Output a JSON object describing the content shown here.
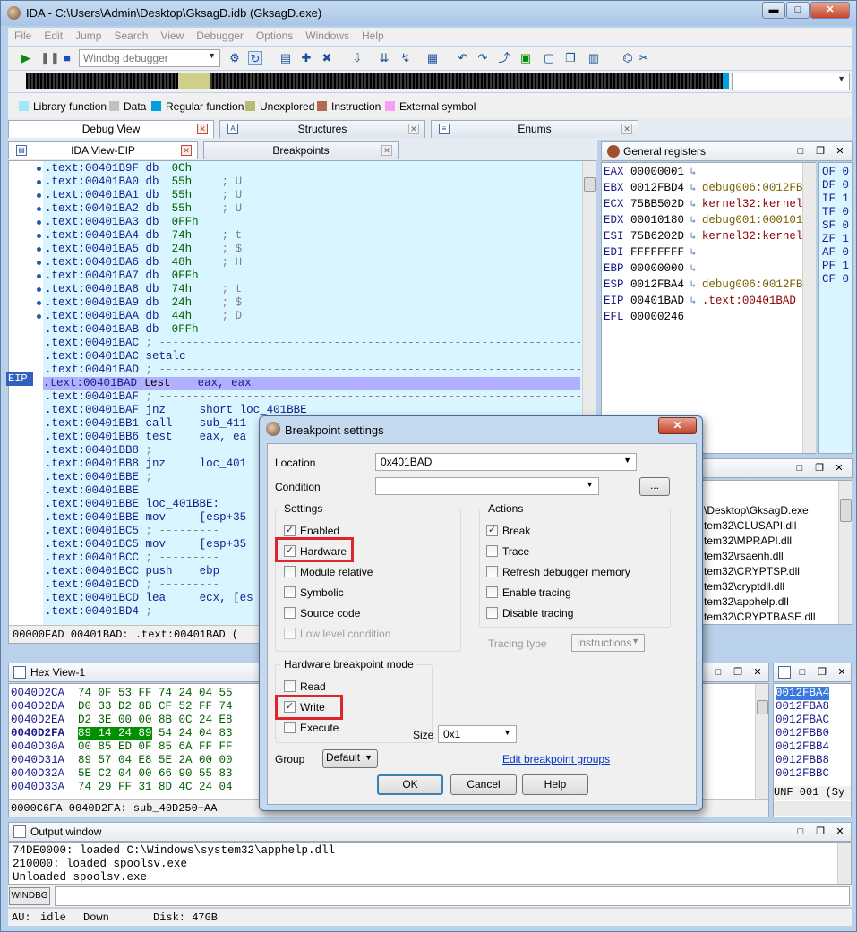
{
  "window": {
    "title": "IDA - C:\\Users\\Admin\\Desktop\\GksagD.idb (GksagD.exe)",
    "minimize": "▬",
    "maximize": "□",
    "close": "✕"
  },
  "menu": [
    "File",
    "Edit",
    "Jump",
    "Search",
    "View",
    "Debugger",
    "Options",
    "Windows",
    "Help"
  ],
  "toolbar": {
    "debugger_select": "Windbg debugger",
    "icons": [
      "play-icon",
      "pause-icon",
      "stop-icon"
    ]
  },
  "legend": [
    {
      "label": "Library function",
      "color": "#9fe8f5"
    },
    {
      "label": "Data",
      "color": "#c0c0c0"
    },
    {
      "label": "Regular function",
      "color": "#00a0e0"
    },
    {
      "label": "Unexplored",
      "color": "#b8b878"
    },
    {
      "label": "Instruction",
      "color": "#b06a50"
    },
    {
      "label": "External symbol",
      "color": "#f5a0f5"
    }
  ],
  "top_tabs": [
    "Debug View",
    "Structures",
    "Enums"
  ],
  "sub_tabs": [
    "IDA View-EIP",
    "Breakpoints"
  ],
  "ida_lines": [
    {
      "addr": ".text:00401B9F",
      "mn": "db",
      "op": "0Ch",
      "cm": ""
    },
    {
      "addr": ".text:00401BA0",
      "mn": "db",
      "op": "55h",
      "cm": "; U"
    },
    {
      "addr": ".text:00401BA1",
      "mn": "db",
      "op": "55h",
      "cm": "; U"
    },
    {
      "addr": ".text:00401BA2",
      "mn": "db",
      "op": "55h",
      "cm": "; U"
    },
    {
      "addr": ".text:00401BA3",
      "mn": "db",
      "op": "0FFh",
      "cm": ""
    },
    {
      "addr": ".text:00401BA4",
      "mn": "db",
      "op": "74h",
      "cm": "; t"
    },
    {
      "addr": ".text:00401BA5",
      "mn": "db",
      "op": "24h",
      "cm": "; $"
    },
    {
      "addr": ".text:00401BA6",
      "mn": "db",
      "op": "48h",
      "cm": "; H"
    },
    {
      "addr": ".text:00401BA7",
      "mn": "db",
      "op": "0FFh",
      "cm": ""
    },
    {
      "addr": ".text:00401BA8",
      "mn": "db",
      "op": "74h",
      "cm": "; t"
    },
    {
      "addr": ".text:00401BA9",
      "mn": "db",
      "op": "24h",
      "cm": "; $"
    },
    {
      "addr": ".text:00401BAA",
      "mn": "db",
      "op": "44h",
      "cm": "; D"
    },
    {
      "addr": ".text:00401BAB",
      "mn": "db",
      "op": "0FFh",
      "cm": ""
    },
    {
      "addr": ".text:00401BAC",
      "mn": "; ---------------------------------------------------------------",
      "op": "",
      "cm": ""
    },
    {
      "addr": ".text:00401BAC",
      "mn": "setalc",
      "op": "",
      "cm": ""
    },
    {
      "addr": ".text:00401BAD",
      "mn": "; ---------------------------------------------------------------",
      "op": "",
      "cm": ""
    },
    {
      "addr": ".text:00401BAD",
      "mn": "test",
      "op": "    eax, eax",
      "cm": ""
    },
    {
      "addr": ".text:00401BAF",
      "mn": "; ---------------------------------------------------------------",
      "op": "",
      "cm": ""
    },
    {
      "addr": ".text:00401BAF",
      "mn": "jnz",
      "op": "     short loc_401BBE",
      "cm": ""
    },
    {
      "addr": ".text:00401BB1",
      "mn": "call",
      "op": "    sub_411",
      "cm": ""
    },
    {
      "addr": ".text:00401BB6",
      "mn": "test",
      "op": "    eax, ea",
      "cm": ""
    },
    {
      "addr": ".text:00401BB8",
      "mn": ";",
      "op": "",
      "cm": ""
    },
    {
      "addr": ".text:00401BB8",
      "mn": "jnz",
      "op": "     loc_401",
      "cm": ""
    },
    {
      "addr": ".text:00401BBE",
      "mn": ";",
      "op": "",
      "cm": ""
    },
    {
      "addr": ".text:00401BBE",
      "mn": "",
      "op": "",
      "cm": ""
    },
    {
      "addr": ".text:00401BBE",
      "mn": "loc_401BBE:",
      "op": "",
      "cm": ""
    },
    {
      "addr": ".text:00401BBE",
      "mn": "mov",
      "op": "     [esp+35",
      "cm": ""
    },
    {
      "addr": ".text:00401BC5",
      "mn": "; ---------",
      "op": "",
      "cm": ""
    },
    {
      "addr": ".text:00401BC5",
      "mn": "mov",
      "op": "     [esp+35",
      "cm": ""
    },
    {
      "addr": ".text:00401BCC",
      "mn": "; ---------",
      "op": "",
      "cm": ""
    },
    {
      "addr": ".text:00401BCC",
      "mn": "push",
      "op": "    ebp",
      "cm": ""
    },
    {
      "addr": ".text:00401BCD",
      "mn": "; ---------",
      "op": "",
      "cm": ""
    },
    {
      "addr": ".text:00401BCD",
      "mn": "lea",
      "op": "     ecx, [es",
      "cm": ""
    },
    {
      "addr": ".text:00401BD4",
      "mn": "; ---------",
      "op": "",
      "cm": ""
    }
  ],
  "eip_label": "EIP",
  "ida_status": "00000FAD 00401BAD: .text:00401BAD (",
  "registers_title": "General registers",
  "registers": [
    {
      "name": "EAX",
      "value": "00000001",
      "label": "",
      "kind": ""
    },
    {
      "name": "EBX",
      "value": "0012FBD4",
      "label": "debug006:0012FB",
      "kind": "d"
    },
    {
      "name": "ECX",
      "value": "75BB502D",
      "label": "kernel32:kernel",
      "kind": "k"
    },
    {
      "name": "EDX",
      "value": "00010180",
      "label": "debug001:000101",
      "kind": "d"
    },
    {
      "name": "ESI",
      "value": "75B6202D",
      "label": "kernel32:kernel",
      "kind": "k"
    },
    {
      "name": "EDI",
      "value": "FFFFFFFF",
      "label": "",
      "kind": ""
    },
    {
      "name": "EBP",
      "value": "00000000",
      "label": "",
      "kind": ""
    },
    {
      "name": "ESP",
      "value": "0012FBA4",
      "label": "debug006:0012FB",
      "kind": "d"
    },
    {
      "name": "EIP",
      "value": "00401BAD",
      "label": ".text:00401BAD",
      "kind": "k"
    },
    {
      "name": "EFL",
      "value": "00000246",
      "label": "",
      "kind": "none"
    }
  ],
  "flags": [
    "OF 0",
    "DF 0",
    "IF 1",
    "TF 0",
    "SF 0",
    "ZF 1",
    "AF 0",
    "PF 1",
    "CF 0"
  ],
  "modules": [
    "\\Desktop\\GksagD.exe",
    "tem32\\CLUSAPI.dll",
    "tem32\\MPRAPI.dll",
    "tem32\\rsaenh.dll",
    "tem32\\CRYPTSP.dll",
    "tem32\\cryptdll.dll",
    "tem32\\apphelp.dll",
    "tem32\\CRYPTBASE.dll"
  ],
  "hex_title": "Hex View-1",
  "hex_lines": [
    {
      "addr": "0040D2CA",
      "bytes": "74 0F 53 FF 74 24 04 55",
      "sel": ""
    },
    {
      "addr": "0040D2DA",
      "bytes": "D0 33 D2 8B CF 52 FF 74",
      "sel": ""
    },
    {
      "addr": "0040D2EA",
      "bytes": "D2 3E 00 00 8B 0C 24 E8",
      "sel": ""
    },
    {
      "addr": "0040D2FA",
      "bytes": " 54 24 04 83",
      "sel": "89 14 24 89"
    },
    {
      "addr": "0040D30A",
      "bytes": "00 85 ED 0F 85 6A FF FF",
      "sel": ""
    },
    {
      "addr": "0040D31A",
      "bytes": "89 57 04 E8 5E 2A 00 00",
      "sel": ""
    },
    {
      "addr": "0040D32A",
      "bytes": "5E C2 04 00 66 90 55 83",
      "sel": ""
    },
    {
      "addr": "0040D33A",
      "bytes": "74 29 FF 31 8D 4C 24 04",
      "sel": ""
    }
  ],
  "hex_status": "0000C6FA 0040D2FA: sub_40D250+AA",
  "stack": [
    "0012FBA4",
    "0012FBA8",
    "0012FBAC",
    "0012FBB0",
    "0012FBB4",
    "0012FBB8",
    "0012FBBC"
  ],
  "stack_status": "UNF 001 (Sy",
  "output_title": "Output window",
  "output_lines": [
    "74DE0000: loaded C:\\Windows\\system32\\apphelp.dll",
    "210000: loaded spoolsv.exe",
    "Unloaded spoolsv.exe"
  ],
  "cmd_button": "WINDBG",
  "status": {
    "au": "AU:",
    "state": "idle",
    "dir": "Down",
    "disk": "Disk: 47GB"
  },
  "dialog": {
    "title": "Breakpoint settings",
    "location_label": "Location",
    "location_value": "0x401BAD",
    "condition_label": "Condition",
    "condition_value": "",
    "ellipsis": "...",
    "settings_title": "Settings",
    "settings": [
      {
        "label": "Enabled",
        "checked": true,
        "disabled": false
      },
      {
        "label": "Hardware",
        "checked": true,
        "disabled": false
      },
      {
        "label": "Module relative",
        "checked": false,
        "disabled": false
      },
      {
        "label": "Symbolic",
        "checked": false,
        "disabled": false
      },
      {
        "label": "Source code",
        "checked": false,
        "disabled": false
      },
      {
        "label": "Low level condition",
        "checked": false,
        "disabled": true
      }
    ],
    "actions_title": "Actions",
    "actions": [
      {
        "label": "Break",
        "checked": true
      },
      {
        "label": "Trace",
        "checked": false
      },
      {
        "label": "Refresh debugger memory",
        "checked": false
      },
      {
        "label": "Enable tracing",
        "checked": false
      },
      {
        "label": "Disable tracing",
        "checked": false
      }
    ],
    "tracing_type_label": "Tracing type",
    "tracing_type_value": "Instructions",
    "hw_title": "Hardware breakpoint mode",
    "hw_modes": [
      {
        "label": "Read",
        "checked": false
      },
      {
        "label": "Write",
        "checked": true
      },
      {
        "label": "Execute",
        "checked": false
      }
    ],
    "size_label": "Size",
    "size_value": "0x1",
    "group_label": "Group",
    "group_value": "Default",
    "edit_groups": "Edit breakpoint groups",
    "ok": "OK",
    "cancel": "Cancel",
    "help": "Help"
  }
}
